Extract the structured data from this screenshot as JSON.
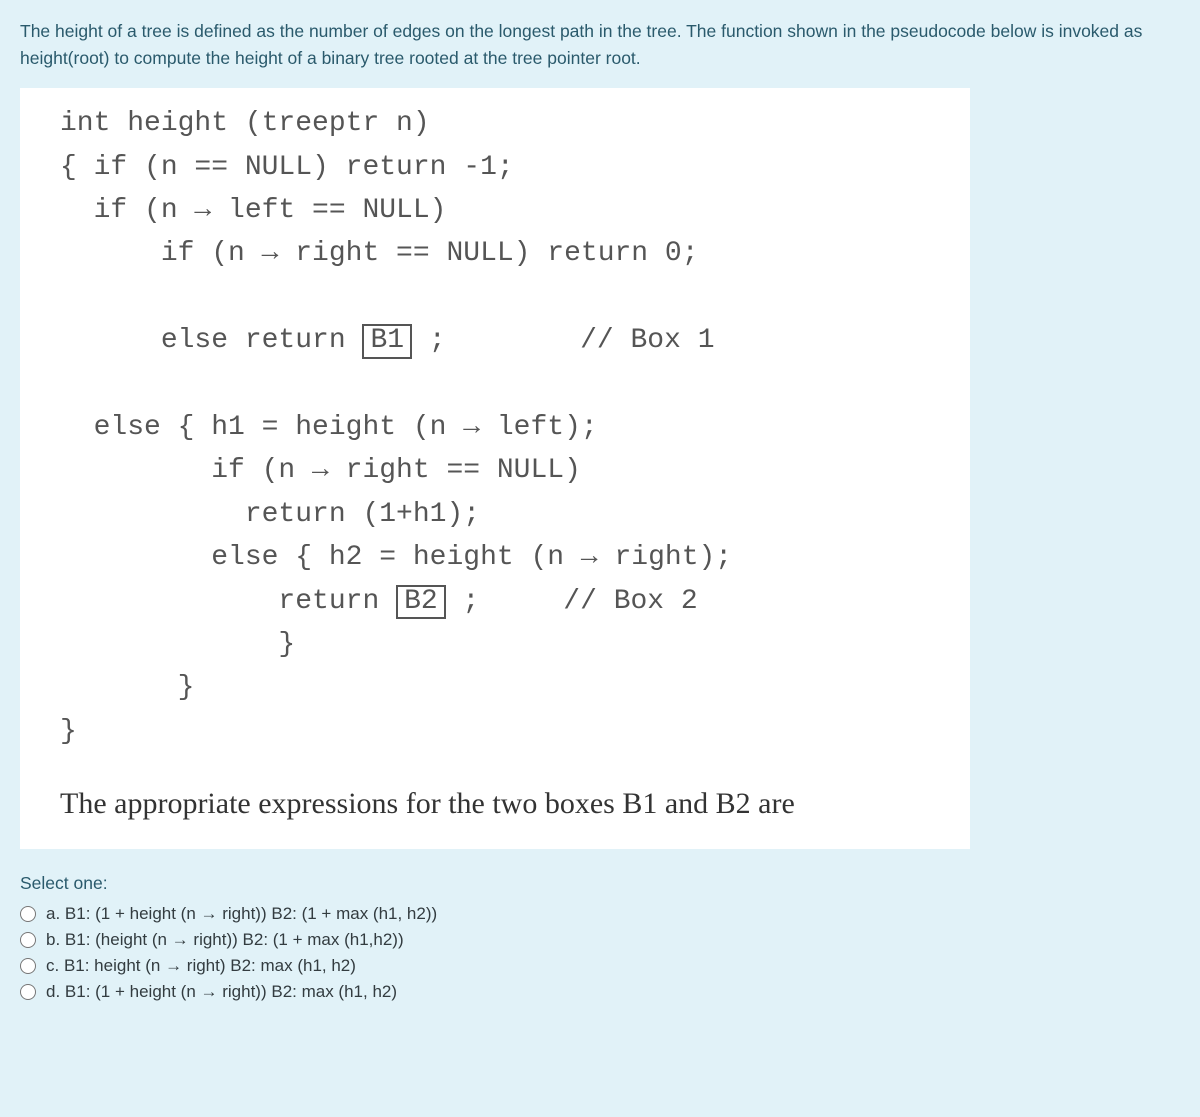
{
  "intro": "The height of a tree is defined as the number of edges on the longest path in the tree. The function shown in the pseudocode below is invoked as height(root) to compute the height of a binary tree rooted at the tree pointer root.",
  "code": {
    "l1": "int height (treeptr n)",
    "l2": "{ if (n == NULL) return -1;",
    "l3": "  if (n → left == NULL)",
    "l4": "      if (n → right == NULL) return 0;",
    "l5a": "      else return ",
    "b1": "B1",
    "l5b": " ;",
    "c1": "// Box 1",
    "l6": "  else { h1 = height (n → left);",
    "l7": "         if (n → right == NULL)",
    "l8": "           return (1+h1);",
    "l9": "         else { h2 = height (n → right);",
    "l10a": "             return ",
    "b2": "B2",
    "l10b": " ;",
    "c2": "// Box 2",
    "l11": "             }",
    "l12": "       }",
    "l13": "}"
  },
  "ending": "The appropriate expressions for the two boxes B1 and B2 are",
  "selectOne": "Select one:",
  "options": {
    "a": "a. B1: (1 + height (n → right)) B2: (1 + max (h1, h2))",
    "b": "b. B1: (height (n → right)) B2: (1 + max (h1,h2))",
    "c": "c. B1: height (n → right) B2: max (h1, h2)",
    "d": "d. B1: (1 + height (n → right)) B2: max (h1, h2)"
  }
}
